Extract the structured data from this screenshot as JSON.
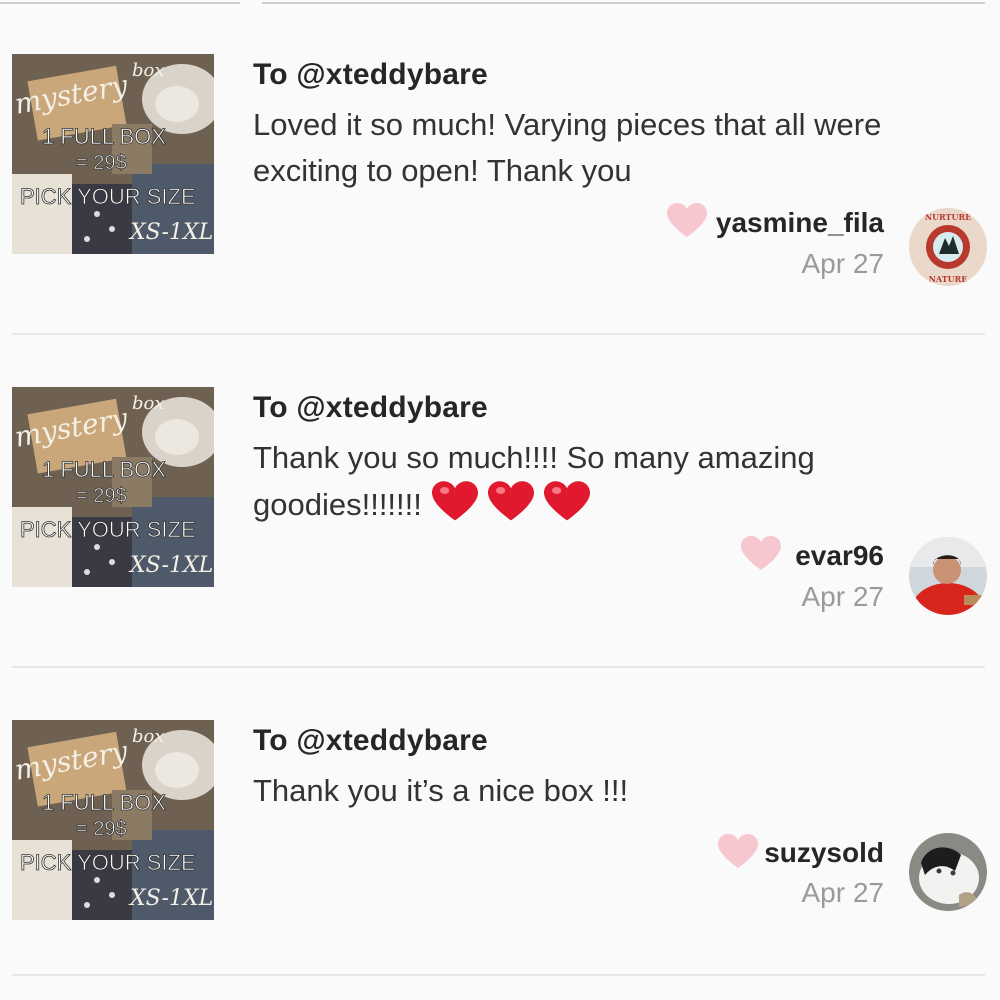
{
  "colors": {
    "background": "#fafafa",
    "divider": "#e6e6e6",
    "like_heart": "#f7c7cf",
    "emoji_heart": "#e0192e",
    "date_text": "#9a9a9a"
  },
  "thumbnail": {
    "script_title": "mystery",
    "script_box": "box",
    "line1": "1 FULL BOX",
    "line2": "= 29$",
    "line3": "PICK YOUR SIZE",
    "line4": "XS-1XL"
  },
  "reviews": [
    {
      "to": "To @xteddybare",
      "message_line1": "Loved it so much! Varying pieces that all were",
      "message_line2": "exciting to open! Thank you",
      "emojis": [],
      "like_icon": "heart-icon",
      "username": "yasmine_fila",
      "date": "Apr 27",
      "avatar_text_top": "NURTURE",
      "avatar_text_bottom": "NATURE"
    },
    {
      "to": "To @xteddybare",
      "message_line1": "Thank you so much!!!! So many amazing",
      "message_line2": "goodies!!!!!!!",
      "emojis": [
        "red-heart-emoji",
        "red-heart-emoji",
        "red-heart-emoji"
      ],
      "like_icon": "heart-icon",
      "username": "evar96",
      "date": "Apr 27"
    },
    {
      "to": "To @xteddybare",
      "message_line1": "Thank you it’s a nice box !!!",
      "message_line2": "",
      "emojis": [],
      "like_icon": "heart-icon",
      "username": "suzysold",
      "date": "Apr 27"
    }
  ]
}
